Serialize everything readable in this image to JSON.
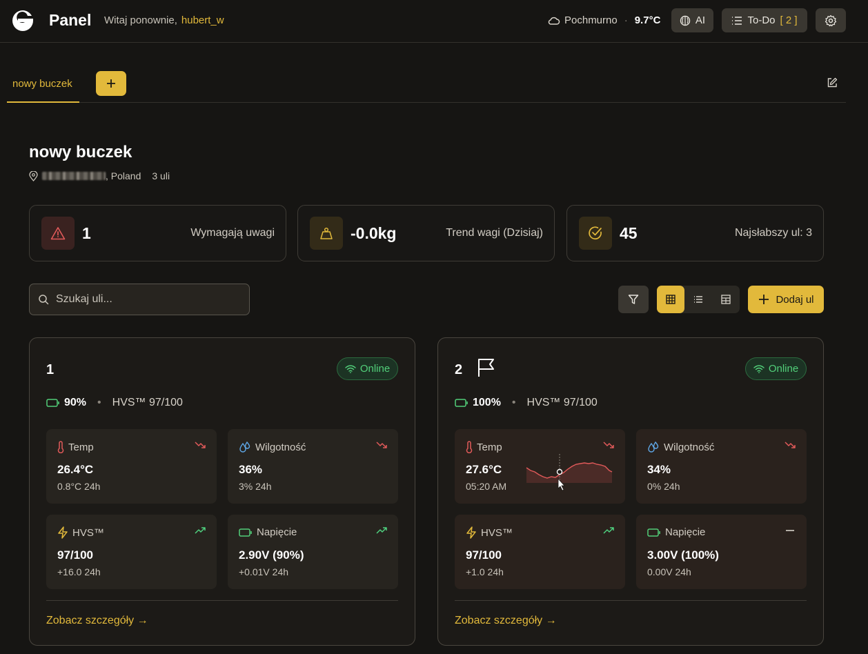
{
  "header": {
    "app_title": "Panel",
    "welcome_text": "Witaj ponownie,",
    "username": "hubert_w",
    "weather_condition": "Pochmurno",
    "weather_sep": "·",
    "weather_temp": "9.7°C",
    "ai_label": "AI",
    "todo_label": "To-Do",
    "todo_count": "[ 2 ]"
  },
  "tabs": {
    "active": "nowy buczek"
  },
  "apiary": {
    "title": "nowy buczek",
    "location_suffix": ", Poland",
    "hive_count": "3 uli"
  },
  "stats": [
    {
      "value": "1",
      "label": "Wymagają uwagi"
    },
    {
      "value": "-0.0kg",
      "label": "Trend wagi (Dzisiaj)"
    },
    {
      "value": "45",
      "label": "Najsłabszy ul: 3"
    }
  ],
  "toolbar": {
    "search_placeholder": "Szukaj uli...",
    "add_hive_label": "Dodaj ul"
  },
  "hives": [
    {
      "number": "1",
      "status": "Online",
      "battery": "90%",
      "hvs": "HVS™ 97/100",
      "metrics": [
        {
          "title": "Temp",
          "value": "26.4°C",
          "sub": "0.8°C 24h"
        },
        {
          "title": "Wilgotność",
          "value": "36%",
          "sub": "3% 24h"
        },
        {
          "title": "HVS™",
          "value": "97/100",
          "sub": "+16.0 24h"
        },
        {
          "title": "Napięcie",
          "value": "2.90V (90%)",
          "sub": "+0.01V 24h"
        }
      ],
      "details_label": "Zobacz szczegóły →"
    },
    {
      "number": "2",
      "status": "Online",
      "battery": "100%",
      "hvs": "HVS™ 97/100",
      "metrics": [
        {
          "title": "Temp",
          "value": "27.6°C",
          "sub": "05:20 AM"
        },
        {
          "title": "Wilgotność",
          "value": "34%",
          "sub": "0% 24h"
        },
        {
          "title": "HVS™",
          "value": "97/100",
          "sub": "+1.0 24h"
        },
        {
          "title": "Napięcie",
          "value": "3.00V (100%)",
          "sub": "0.00V 24h"
        }
      ],
      "details_label": "Zobacz szczegóły →"
    }
  ],
  "colors": {
    "accent": "#e2b93b",
    "online_green": "#52d07a",
    "trend_down": "#e25a5a",
    "trend_up": "#4fd17f",
    "background": "#161513"
  }
}
